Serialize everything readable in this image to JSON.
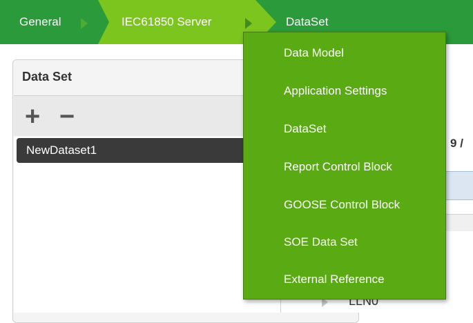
{
  "breadcrumb": {
    "items": [
      {
        "label": "General"
      },
      {
        "label": "IEC61850 Server"
      },
      {
        "label": "DataSet"
      }
    ]
  },
  "panel": {
    "title": "Data Set",
    "add_icon": "+",
    "remove_icon": "−",
    "list": [
      {
        "label": "NewDataset1",
        "selected": true
      }
    ]
  },
  "right_pane": {
    "count_label_partial": "t: 9 /",
    "tree_item": "LLN0"
  },
  "menu": {
    "items": [
      {
        "label": "Data Model"
      },
      {
        "label": "Application Settings"
      },
      {
        "label": "DataSet"
      },
      {
        "label": "Report Control Block"
      },
      {
        "label": "GOOSE Control Block"
      },
      {
        "label": "SOE Data Set"
      },
      {
        "label": "External Reference"
      }
    ]
  },
  "colors": {
    "breadcrumb_bg": "#2a9a3a",
    "breadcrumb_active": "#7cc41e",
    "menu_bg": "#5aaa14",
    "selected_row": "#3a3a3a"
  }
}
